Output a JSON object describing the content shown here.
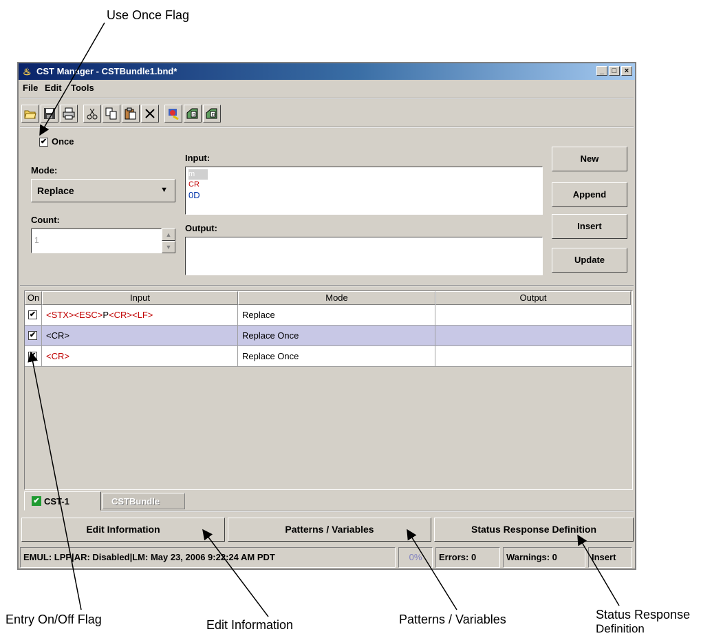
{
  "callouts": {
    "use_once_flag": "Use Once Flag",
    "entry_on_off_flag": "Entry On/Off Flag",
    "edit_information": "Edit Information",
    "patterns_variables": "Patterns / Variables",
    "status_response_definition_1": "Status Response",
    "status_response_definition_2": "Definition"
  },
  "window": {
    "title": "CST Manager - CSTBundle1.bnd*",
    "controls": {
      "minimize": "_",
      "maximize": "□",
      "close": "×"
    }
  },
  "menu": {
    "file": "File",
    "edit": "Edit",
    "tools": "Tools"
  },
  "toolbar": {
    "icons": [
      "open-icon",
      "save-icon",
      "print-icon",
      "cut-icon",
      "copy-icon",
      "paste-icon",
      "delete-icon",
      "find-icon",
      "export-0-icon",
      "export-d-icon"
    ]
  },
  "editor": {
    "once_label": "Once",
    "once_checked": true,
    "mode_label": "Mode:",
    "mode_value": "Replace",
    "count_label": "Count:",
    "count_value": "1",
    "input_label": "Input:",
    "input_lines": [
      "m",
      "CR",
      "0D"
    ],
    "output_label": "Output:",
    "output_value": ""
  },
  "buttons": {
    "new": "New",
    "append": "Append",
    "insert": "Insert",
    "update": "Update"
  },
  "table": {
    "headers": {
      "on": "On",
      "input": "Input",
      "mode": "Mode",
      "output": "Output"
    },
    "rows": [
      {
        "on": true,
        "input": "<STX><ESC>P<CR><LF>",
        "mode": "Replace",
        "output": ""
      },
      {
        "on": true,
        "input": "<CR>",
        "mode": "Replace Once",
        "output": ""
      },
      {
        "on": true,
        "input": "<CR>",
        "mode": "Replace Once",
        "output": ""
      }
    ]
  },
  "tabs": {
    "cst1": "CST-1",
    "bundle": "CSTBundle"
  },
  "bottom_buttons": {
    "edit_information": "Edit Information",
    "patterns_variables": "Patterns / Variables",
    "status_response_definition": "Status Response Definition"
  },
  "status": {
    "info": "EMUL: LPP|AR: Disabled|LM: May 23, 2006 9:22:24 AM PDT",
    "progress": "0%",
    "errors": "Errors: 0",
    "warnings": "Warnings: 0",
    "mode": "Insert"
  },
  "colors": {
    "title_start": "#0a246a",
    "title_end": "#a6caf0",
    "selected_row": "#c8c8e6",
    "input_red": "#c00000",
    "input_blue": "#0033aa"
  }
}
